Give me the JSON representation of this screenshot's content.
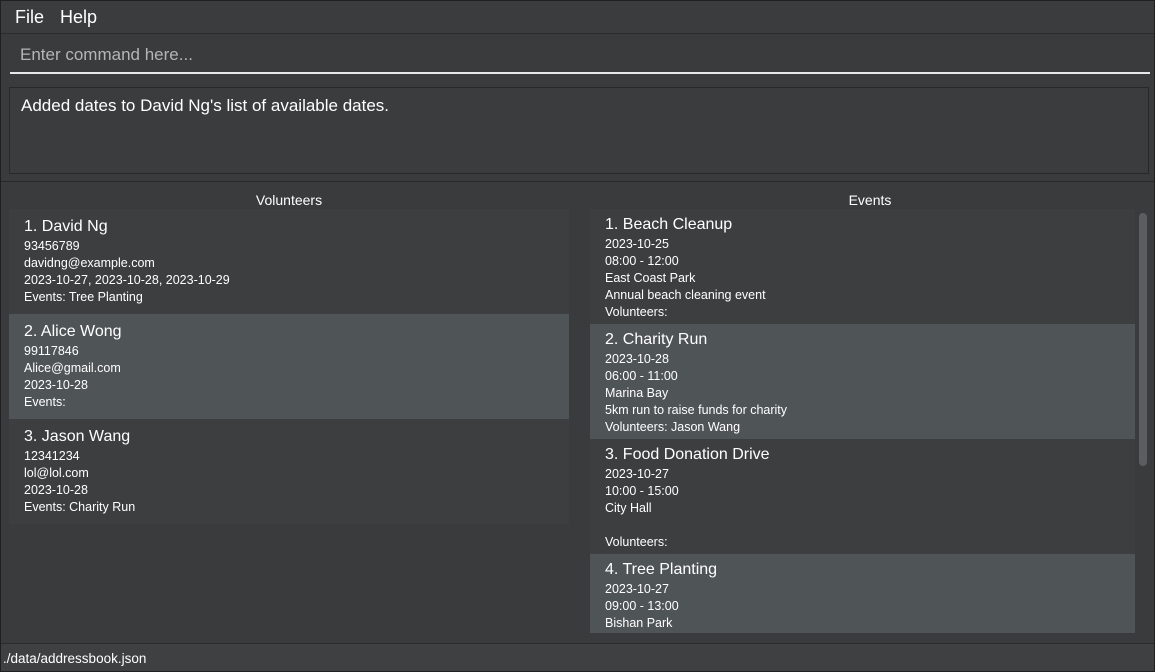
{
  "menu": {
    "file": "File",
    "help": "Help"
  },
  "command": {
    "placeholder": "Enter command here...",
    "value": ""
  },
  "result": {
    "text": "Added dates to David Ng's list of available dates."
  },
  "volunteers": {
    "title": "Volunteers",
    "items": [
      {
        "title": "1. David Ng",
        "phone": "93456789",
        "email": "davidng@example.com",
        "dates": "2023-10-27, 2023-10-28, 2023-10-29",
        "events": "Events: Tree Planting"
      },
      {
        "title": "2. Alice Wong",
        "phone": "99117846",
        "email": "Alice@gmail.com",
        "dates": "2023-10-28",
        "events": "Events:"
      },
      {
        "title": "3. Jason Wang",
        "phone": "12341234",
        "email": "lol@lol.com",
        "dates": "2023-10-28",
        "events": "Events: Charity Run"
      }
    ]
  },
  "events": {
    "title": "Events",
    "items": [
      {
        "title": "1. Beach Cleanup",
        "date": "2023-10-25",
        "time": "08:00 - 12:00",
        "location": "East Coast Park",
        "description": "Annual beach cleaning event",
        "volunteers": "Volunteers:"
      },
      {
        "title": "2. Charity Run",
        "date": "2023-10-28",
        "time": "06:00 - 11:00",
        "location": "Marina Bay",
        "description": "5km run to raise funds for charity",
        "volunteers": "Volunteers: Jason Wang"
      },
      {
        "title": "3. Food Donation Drive",
        "date": "2023-10-27",
        "time": "10:00 - 15:00",
        "location": "City Hall",
        "description": "",
        "volunteers": "Volunteers:"
      },
      {
        "title": "4. Tree Planting",
        "date": "2023-10-27",
        "time": "09:00 - 13:00",
        "location": "Bishan Park",
        "description": "",
        "volunteers": ""
      }
    ]
  },
  "status": {
    "path": "./data/addressbook.json"
  }
}
